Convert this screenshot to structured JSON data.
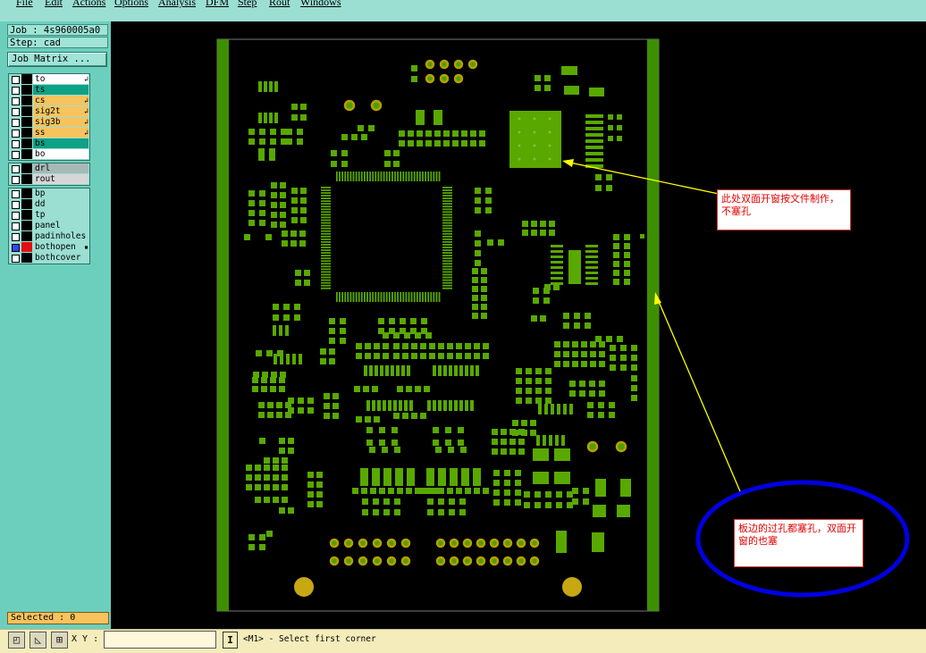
{
  "menu": [
    "File",
    "Edit",
    "Actions",
    "Options",
    "Analysis",
    "DFM",
    "Step",
    "Rout",
    "Windows"
  ],
  "job_label": "Job : 4s960005a0",
  "step_label": "Step: cad",
  "job_matrix_button": "Job Matrix ...",
  "layer_groups": [
    [
      {
        "name": "to",
        "color": "#ffffff",
        "arrow": "↲"
      },
      {
        "name": "ts",
        "color": "#0fa186",
        "arrow": ""
      },
      {
        "name": "cs",
        "color": "#f6c35c",
        "arrow": "↲"
      },
      {
        "name": "sig2t",
        "color": "#f6c35c",
        "arrow": "↲"
      },
      {
        "name": "sig3b",
        "color": "#f6c35c",
        "arrow": "↲"
      },
      {
        "name": "ss",
        "color": "#f6c35c",
        "arrow": "↲"
      },
      {
        "name": "bs",
        "color": "#0fa186",
        "arrow": ""
      },
      {
        "name": "bo",
        "color": "#ffffff",
        "arrow": ""
      }
    ],
    [
      {
        "name": "drl",
        "color": "#a8b8b6",
        "arrow": ""
      },
      {
        "name": "rout",
        "color": "#d6d6d6",
        "arrow": ""
      }
    ],
    [
      {
        "name": "bp",
        "color": "#9adfd2",
        "arrow": ""
      },
      {
        "name": "dd",
        "color": "#9adfd2",
        "arrow": ""
      },
      {
        "name": "tp",
        "color": "#9adfd2",
        "arrow": ""
      },
      {
        "name": "panel",
        "color": "#9adfd2",
        "arrow": ""
      },
      {
        "name": "padinholes",
        "color": "#9adfd2",
        "arrow": ""
      },
      {
        "name": "bothopen",
        "color": "#9adfd2",
        "arrow": "▪",
        "active": true
      },
      {
        "name": "bothcover",
        "color": "#9adfd2",
        "arrow": ""
      }
    ]
  ],
  "selected_label": "Selected : 0",
  "xy_label": "X Y :",
  "xy_value": "",
  "info_button": "I",
  "prompt": "<M1> - Select first corner",
  "annotations": {
    "note1": "此处双面开窗按文件制作，不塞孔",
    "note2": "板边的过孔都塞孔，双面开窗的也塞"
  },
  "colors": {
    "pcb_copper": "#58a800",
    "pcb_edge": "#3e8f00",
    "via_ring": "#b8a000",
    "via_hole": "#4ca000",
    "highlight_ellipse": "#0000e0",
    "arrow": "#ffff00",
    "panel_bg": "#6ccfbd"
  },
  "icons": [
    "zoom-area-icon",
    "measure-icon",
    "grid-snap-icon"
  ]
}
